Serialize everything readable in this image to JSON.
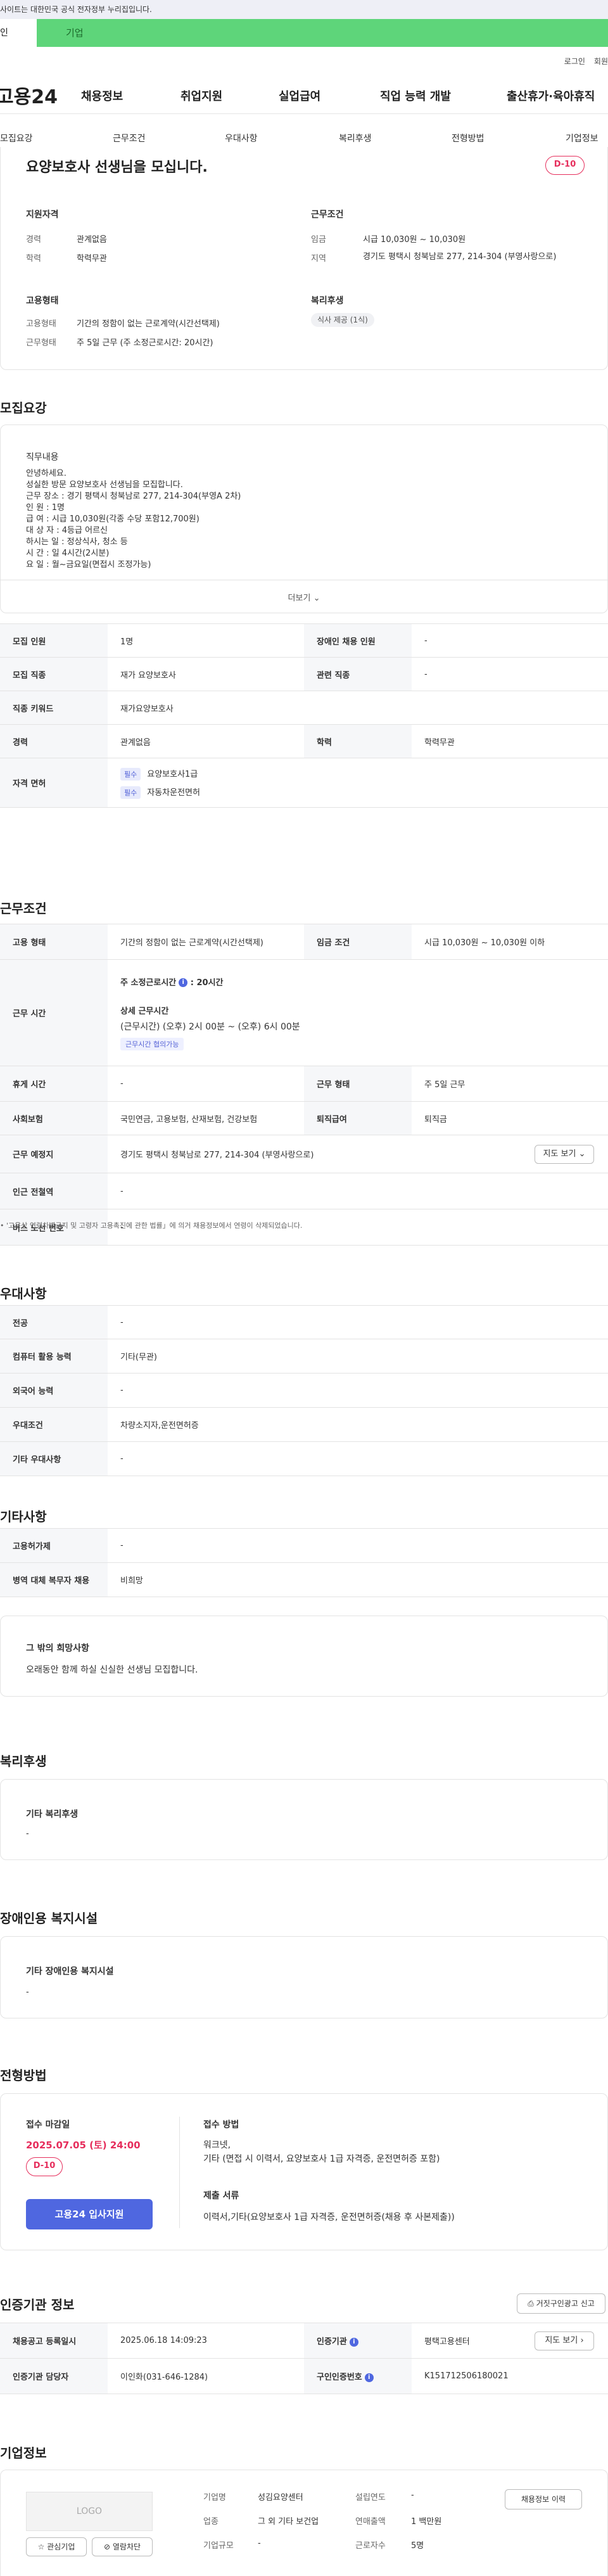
{
  "topbar": {
    "notice": "사이트는 대한민국 공식 전자정부 누리집입니다."
  },
  "tabs": {
    "individual": "인",
    "enterprise": "기업"
  },
  "util": {
    "login": "로그인",
    "join": "회원"
  },
  "gnb": {
    "logo": "고용24",
    "items": [
      "채용정보",
      "취업지원",
      "실업급여",
      "직업 능력 개발",
      "출산휴가·육아휴직"
    ]
  },
  "subnav": [
    "모집요강",
    "근무조건",
    "우대사항",
    "복리후생",
    "전형방법",
    "기업정보"
  ],
  "summary": {
    "title": "요양보호사 선생님을 모십니다.",
    "dday": "D-10",
    "qual_title": "지원자격",
    "career_label": "경력",
    "career": "관계없음",
    "edu_label": "학력",
    "edu": "학력무관",
    "cond_title": "근무조건",
    "wage_label": "임금",
    "wage": "시급 10,030원 ~ 10,030원",
    "area_label": "지역",
    "area": "경기도 평택시 청북남로 277, 214-304 (부영사랑으로)",
    "emp_title": "고용형태",
    "emp_type_label": "고용형태",
    "emp_type": "기간의 정함이 없는 근로계약(시간선택제)",
    "work_type_label": "근무형태",
    "work_type": "주 5일 근무 (주 소정근로시간: 20시간)",
    "welfare_title": "복리후생",
    "welfare_tag": "식사 제공 (1식)"
  },
  "recruit": {
    "section_title": "모집요강",
    "duty_title": "직무내용",
    "duty_lines": [
      "안녕하세요.",
      "성실한 방문 요양보호사 선생님을 모집합니다.",
      "근무 장소 : 경기 평택시 청북남로 277, 214-304(부영A 2차)",
      "인        원 : 1명",
      "급        여 : 시급 10,030원(각종 수당 포함12,700원)",
      "대   상   자 : 4등급 어르신",
      "하시는 일 : 정상식사, 청소 등",
      "시        간 : 일 4시간(2시분)",
      "요        일 : 월~금요일(면접시 조정가능)"
    ],
    "more": "더보기",
    "rows": [
      [
        "모집 인원",
        "1명",
        "장애인 채용 인원",
        "-"
      ],
      [
        "모집 직종",
        "재가 요양보호사",
        "관련 직종",
        "-"
      ],
      [
        "직종 키워드",
        "재가요양보호사",
        "",
        ""
      ],
      [
        "경력",
        "관계없음",
        "학력",
        "학력무관"
      ]
    ],
    "license_label": "자격 면허",
    "licenses": [
      {
        "tag": "필수",
        "name": "요양보호사1급"
      },
      {
        "tag": "필수",
        "name": "자동차운전면허"
      }
    ]
  },
  "work": {
    "section_title": "근무조건",
    "emp_label": "고용 형태",
    "emp": "기간의 정함이 없는 근로계약(시간선택제)",
    "wage_label": "임금 조건",
    "wage": "시급 10,030원 ~ 10,030원 이하",
    "time_label": "근무 시간",
    "weekly": "주 소정근로시간",
    "weekly_hours": ": 20시간",
    "detail_title": "상세 근무시간",
    "detail": "(근무시간) (오후) 2시 00분 ~ (오후) 6시 00분",
    "negotiable": "근무시간 협의가능",
    "rest_label": "휴게 시간",
    "rest": "-",
    "form_label": "근무 형태",
    "form": "주 5일 근무",
    "insurance_label": "사회보험",
    "insurance": "국민연금, 고용보험, 산재보험, 건강보험",
    "retire_label": "퇴직급여",
    "retire": "퇴직금",
    "place_label": "근무 예정지",
    "place": "경기도 평택시 청북남로 277, 214-304 (부영사랑으로)",
    "map_btn": "지도 보기",
    "subway_label": "인근 전철역",
    "subway": "-",
    "bus_label": "버스 노선 번호",
    "bus": "-",
    "footnote": "'고용상 연령차별금지 및 고령자 고용촉진에 관한 법률」에 의거 채용정보에서 연령이 삭제되었습니다."
  },
  "pref": {
    "section_title": "우대사항",
    "rows": [
      [
        "전공",
        "-"
      ],
      [
        "컴퓨터 활용 능력",
        "기타(무관)"
      ],
      [
        "외국어 능력",
        "-"
      ],
      [
        "우대조건",
        "차량소지자,운전면허증"
      ],
      [
        "기타 우대사항",
        "-"
      ]
    ]
  },
  "etc": {
    "section_title": "기타사항",
    "rows": [
      [
        "고용허가제",
        "-"
      ],
      [
        "병역 대체 복무자 채용",
        "비희망"
      ]
    ],
    "card_title": "그 밖의 희망사항",
    "card_text": "오래동안 함께 하실 신실한 선생님 모집합니다."
  },
  "welfare": {
    "section_title": "복리후생",
    "card_title": "기타 복리후생",
    "card_text": "-"
  },
  "disabled": {
    "section_title": "장애인용 복지시설",
    "card_title": "기타 장애인용 복지시설",
    "card_text": "-"
  },
  "apply": {
    "section_title": "전형방법",
    "deadline_title": "접수 마감일",
    "deadline": "2025.07.05 (토) 24:00",
    "dday": "D-10",
    "apply_btn": "고용24 입사지원",
    "method_title": "접수 방법",
    "method_lines": [
      "워크넷,",
      "기타 (면접 시 이력서, 요양보호사 1급 자격증, 운전면허증 포함)"
    ],
    "docs_title": "제출 서류",
    "docs": "이력서,기타(요양보호사 1급 자격증, 운전면허증(채용 후 사본제출))"
  },
  "agency": {
    "section_title": "인증기관 정보",
    "report_btn": "거짓구인광고 신고",
    "reg_label": "채용공고 등록일시",
    "reg": "2025.06.18 14:09:23",
    "org_label": "인증기관",
    "org": "평택고용센터",
    "map_btn": "지도 보기",
    "manager_label": "인증기관 담당자",
    "manager": "이인화(031-646-1284)",
    "num_label": "구인인증번호",
    "num": "K151712506180021"
  },
  "company": {
    "section_title": "기업정보",
    "logo": "LOGO",
    "fav_btn": "관심기업",
    "block_btn": "열람차단",
    "name_label": "기업명",
    "name": "성김요양센터",
    "year_label": "설립연도",
    "year": "-",
    "industry_label": "업종",
    "industry": "그 외 기타 보건업",
    "sales_label": "연매출액",
    "sales": "1 백만원",
    "scale_label": "기업규모",
    "scale": "-",
    "staff_label": "근로자수",
    "staff": "5명",
    "history_btn": "채용정보 이력"
  },
  "colors": {
    "accent": "#4f67e0",
    "dday": "#e62e5c",
    "enterprise": "#5ed57a"
  }
}
